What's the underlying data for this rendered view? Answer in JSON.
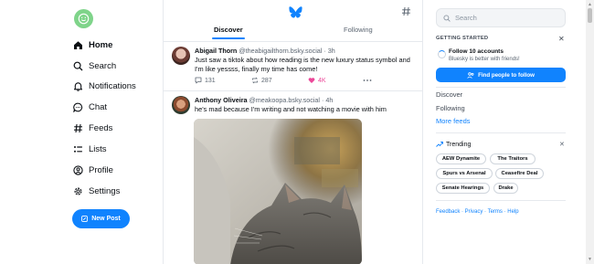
{
  "nav": {
    "items": [
      {
        "label": "Home",
        "icon": "home-icon"
      },
      {
        "label": "Search",
        "icon": "search-icon"
      },
      {
        "label": "Notifications",
        "icon": "bell-icon"
      },
      {
        "label": "Chat",
        "icon": "chat-icon"
      },
      {
        "label": "Feeds",
        "icon": "hash-icon"
      },
      {
        "label": "Lists",
        "icon": "list-icon"
      },
      {
        "label": "Profile",
        "icon": "profile-icon"
      },
      {
        "label": "Settings",
        "icon": "gear-icon"
      }
    ],
    "new_post": "New Post"
  },
  "feed": {
    "tabs": [
      "Discover",
      "Following"
    ],
    "posts": [
      {
        "author": "Abigail Thorn",
        "handle": "@theabigailthorn.bsky.social",
        "time": "· 3h",
        "text": "Just saw a tiktok about how reading is the new luxury status symbol and I'm like yessss, finally my time has come!",
        "replies": "131",
        "reposts": "287",
        "likes": "4K"
      },
      {
        "author": "Anthony Oliveira",
        "handle": "@meakoopa.bsky.social",
        "time": "· 4h",
        "text": "he's mad because I'm writing and not watching a movie with him"
      }
    ]
  },
  "sidebar": {
    "search_placeholder": "Search",
    "getting_started": {
      "title": "GETTING STARTED",
      "task": "Follow 10 accounts",
      "subtitle": "Bluesky is better with friends!",
      "button": "Find people to follow"
    },
    "links": [
      "Discover",
      "Following",
      "More feeds"
    ],
    "trending": {
      "title": "Trending",
      "topics": [
        "AEW Dynamite",
        "The Traitors",
        "Spurs vs Arsenal",
        "Ceasefire Deal",
        "Senate Hearings",
        "Drake"
      ]
    },
    "footer": "Feedback · Privacy · Terms · Help"
  },
  "colors": {
    "accent": "#1083fe",
    "like": "#ec4899",
    "avatar": "#7fd48a"
  }
}
